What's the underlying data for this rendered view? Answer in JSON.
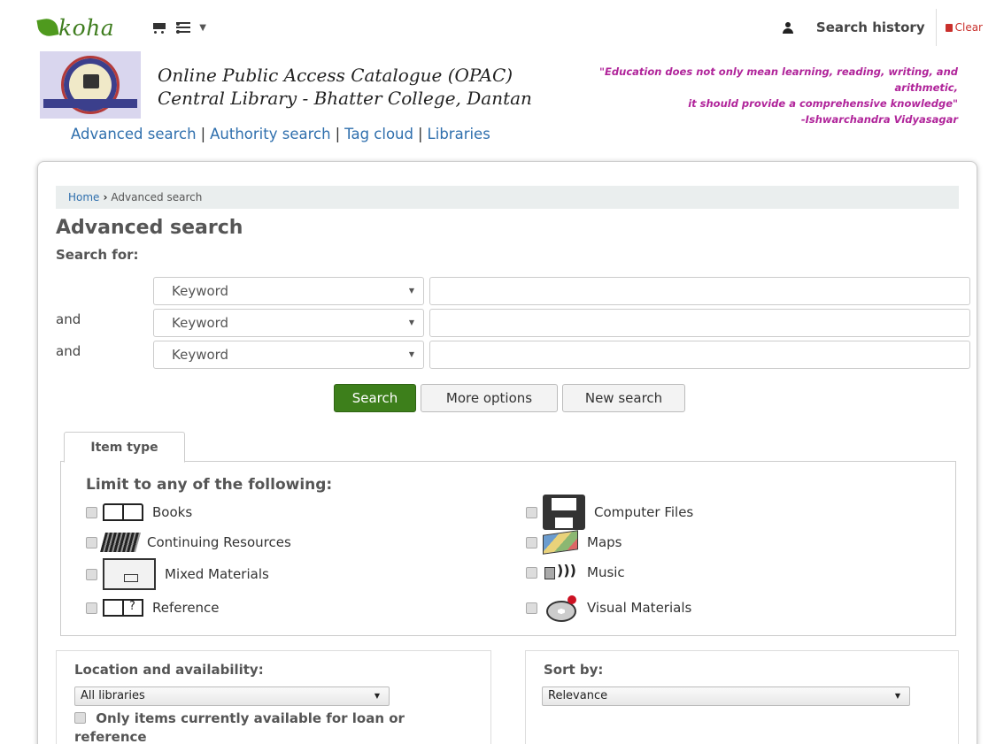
{
  "navbar": {
    "logo_text": "koha",
    "cart_icon": "cart-icon",
    "lists_icon": "lists-icon",
    "user_icon": "user-icon",
    "search_history": "Search history",
    "clear": "Clear"
  },
  "header": {
    "title_line1": "Online Public Access Catalogue (OPAC)",
    "title_line2": "Central Library - Bhatter College, Dantan",
    "quote_line1": "\"Education does not only mean learning, reading, writing, and",
    "quote_line2": "arithmetic,",
    "quote_line3": "it should provide a comprehensive knowledge\"",
    "quote_author": "-Ishwarchandra Vidyasagar",
    "quote_color": "#b0249a"
  },
  "top_links": [
    "Advanced search",
    "Authority search",
    "Tag cloud",
    "Libraries"
  ],
  "breadcrumb": {
    "home": "Home",
    "current": "Advanced search"
  },
  "page_title": "Advanced search",
  "search_for": "Search for:",
  "rows": [
    {
      "op": "",
      "field": "Keyword",
      "value": ""
    },
    {
      "op": "and",
      "field": "Keyword",
      "value": ""
    },
    {
      "op": "and",
      "field": "Keyword",
      "value": ""
    }
  ],
  "buttons": {
    "search": "Search",
    "more_options": "More options",
    "new_search": "New search"
  },
  "accent_color": "#3d7f1b",
  "item_type": {
    "tab": "Item type",
    "limit_title": "Limit to any of the following:",
    "left": [
      {
        "label": "Books",
        "icon": "book-icon"
      },
      {
        "label": "Continuing Resources",
        "icon": "serials-icon"
      },
      {
        "label": "Mixed Materials",
        "icon": "box-icon"
      },
      {
        "label": "Reference",
        "icon": "reference-icon"
      }
    ],
    "right": [
      {
        "label": "Computer Files",
        "icon": "floppy-icon"
      },
      {
        "label": "Maps",
        "icon": "map-icon"
      },
      {
        "label": "Music",
        "icon": "speaker-icon"
      },
      {
        "label": "Visual Materials",
        "icon": "disc-icon"
      }
    ]
  },
  "location": {
    "title": "Location and availability:",
    "library_select": "All libraries",
    "availability": "Only items currently available for loan or reference"
  },
  "sort": {
    "title": "Sort by:",
    "select": "Relevance"
  }
}
